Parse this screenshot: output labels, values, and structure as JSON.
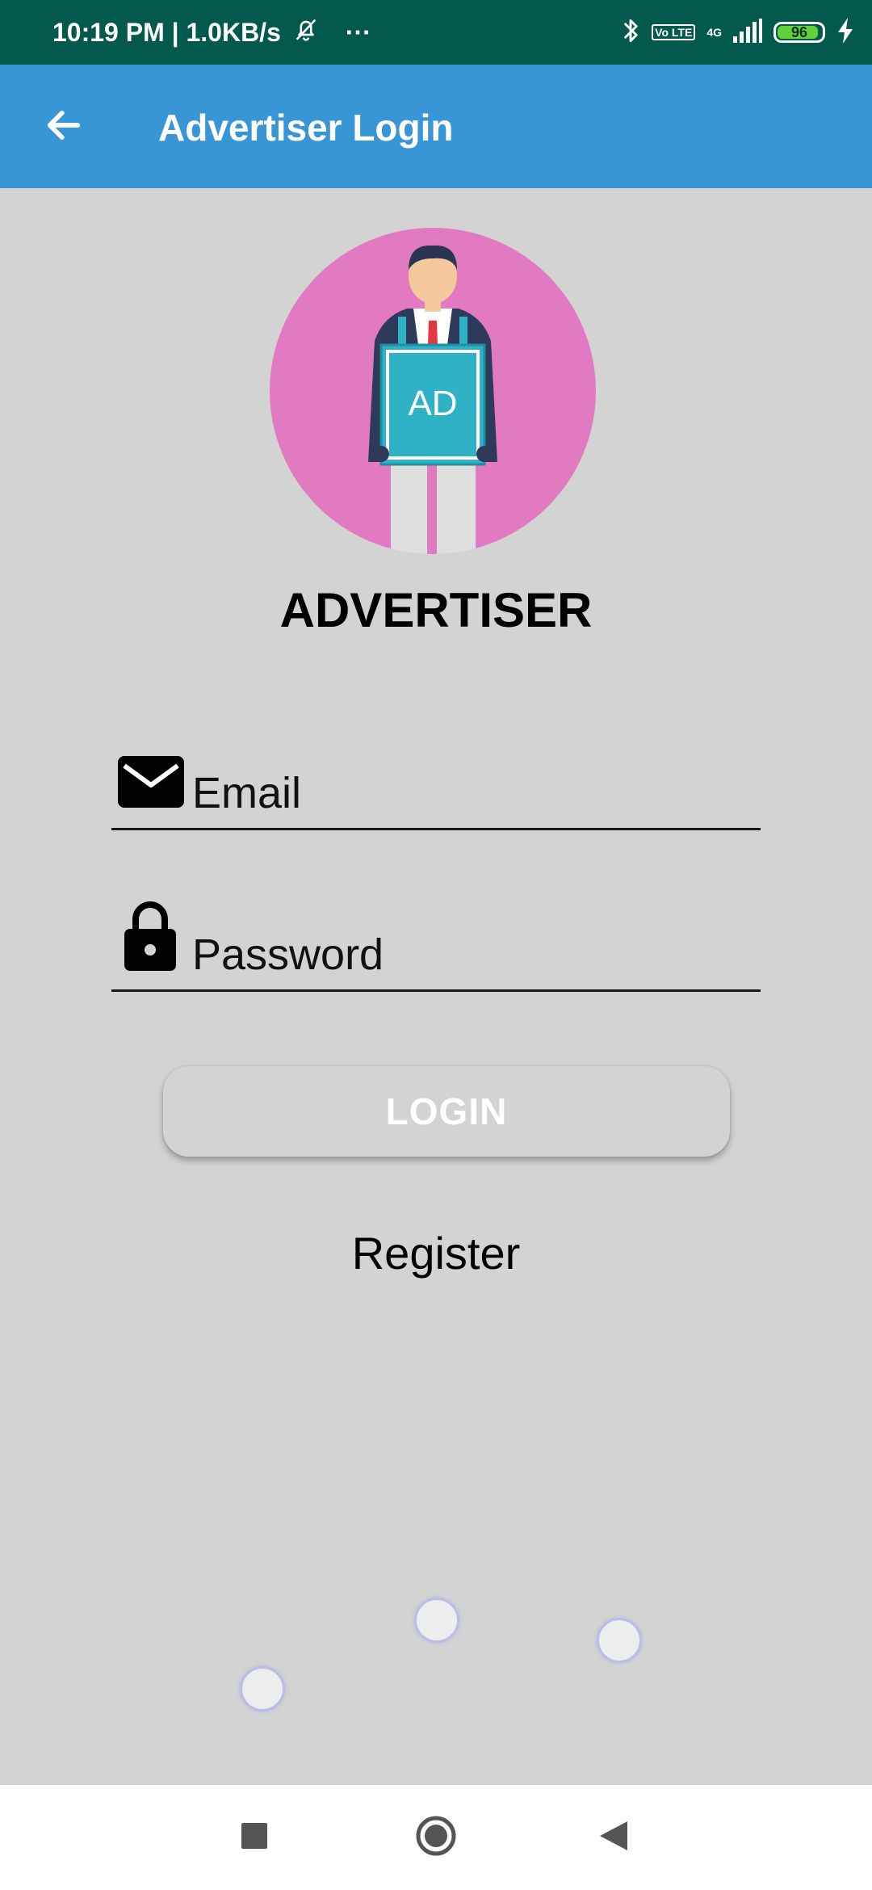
{
  "status_bar": {
    "time_speed": "10:19 PM | 1.0KB/s",
    "more": "···",
    "volte": "Vo LTE",
    "network": "4G",
    "battery_level": "96",
    "icons": [
      "bell-off-icon",
      "bluetooth-icon",
      "signal-icon",
      "charging-icon"
    ]
  },
  "app_bar": {
    "title": "Advertiser Login",
    "back_icon": "arrow-left-icon",
    "color": "#3996d6"
  },
  "avatar": {
    "board_text": "AD",
    "background": "#e27ac2"
  },
  "role_title": "ADVERTISER",
  "form": {
    "email_placeholder": "Email",
    "password_placeholder": "Password",
    "email_icon": "mail-icon",
    "password_icon": "lock-icon"
  },
  "login_button": "LOGIN",
  "register_link": "Register",
  "nav": {
    "recents_icon": "square-icon",
    "home_icon": "circle-icon",
    "back_icon": "triangle-back-icon"
  }
}
